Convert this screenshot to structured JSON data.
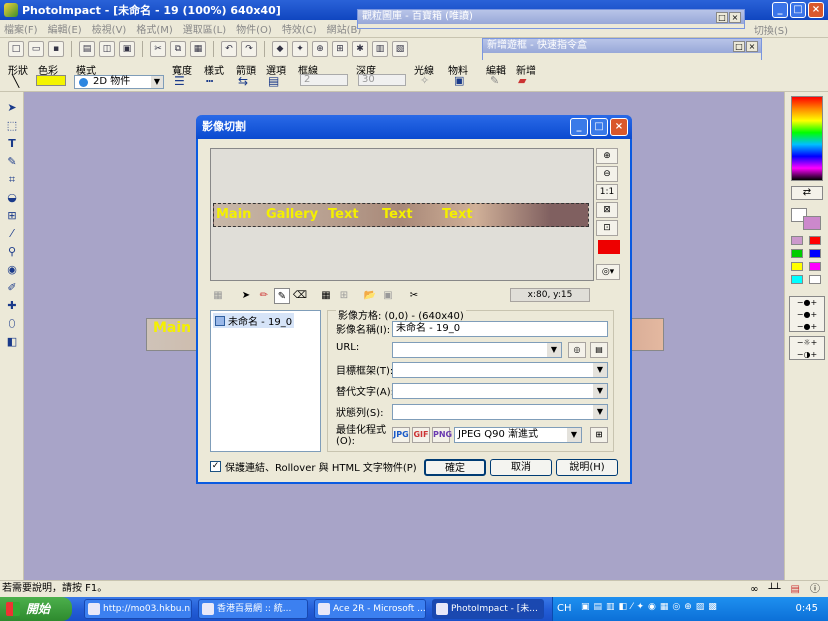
{
  "app": {
    "title": "PhotoImpact - [未命名 - 19 (100%) 640x40]"
  },
  "menu": {
    "items": [
      "檔案(F)",
      "編輯(E)",
      "檢視(V)",
      "格式(M)",
      "選取區(L)",
      "物件(O)",
      "特效(C)",
      "網站(B)"
    ],
    "right": "切換(S)"
  },
  "attrbar": {
    "shape_label": "形狀",
    "color_label": "色彩",
    "mode_label": "模式",
    "mode_value": "2D 物件",
    "width_label": "寬度",
    "style_label": "樣式",
    "arrow_label": "箭頭",
    "option_label": "選項",
    "border_label": "框線",
    "border_value": "2",
    "depth_label": "深度",
    "depth_value": "30",
    "light_label": "光線",
    "material_label": "物料",
    "edit_label": "編輯",
    "new_label": "新增"
  },
  "floating": {
    "gallery_title": "觀粒圖庫 - 百寶箱 (唯讀)",
    "quick_title": "新增遊框 - 快速指令盒"
  },
  "canvas": {
    "text": "Main"
  },
  "dialog": {
    "title": "影像切割",
    "preview_texts": [
      "Main",
      "Gallery",
      "Text",
      "Text",
      "Text"
    ],
    "coords": "x:80, y:15",
    "list_item": "未命名 - 19_0",
    "props_label": "影像方格: (0,0) - (640x40)",
    "image_name_label": "影像名稱(I):",
    "image_name_value": "未命名 - 19_0",
    "url_label": "URL:",
    "target_label": "目標框架(T):",
    "alt_label": "替代文字(A):",
    "status_label": "狀態列(S):",
    "optimize_label": "最佳化程式(O):",
    "optimize_value": "JPEG Q90 漸進式",
    "checkbox_label": "保護連結、Rollover 與 HTML 文字物件(P)",
    "ok": "確定",
    "cancel": "取消",
    "help": "說明(H)"
  },
  "status": {
    "text": "若需要說明，請按 F1。"
  },
  "taskbar": {
    "start": "開始",
    "tasks": [
      "http://mo03.hkbu.n...",
      "香港百易網 :: 統...",
      "Ace 2R - Microsoft ...",
      "PhotoImpact - [未..."
    ],
    "ime": "CH",
    "clock": "0:45"
  }
}
